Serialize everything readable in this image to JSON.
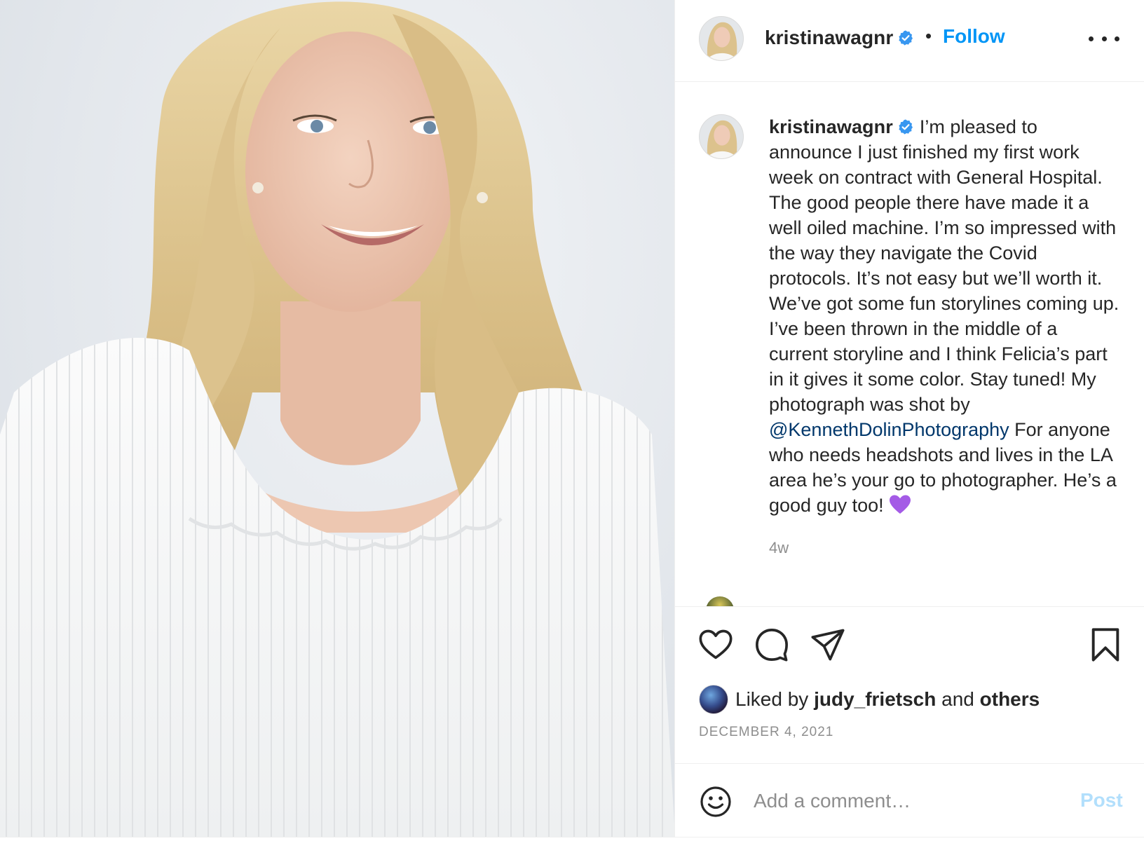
{
  "colors": {
    "accent": "#0095f6",
    "mention": "#00376b",
    "verified": "#3897f0",
    "muted": "#8e8e8e",
    "post_disabled": "#b2dffc",
    "heart_emoji": "#a45be6"
  },
  "header": {
    "username": "kristinawagnr",
    "separator": "•",
    "follow_label": "Follow",
    "more_icon": "more-horizontal-icon"
  },
  "caption": {
    "username": "kristinawagnr",
    "text_before_mention": "I’m pleased to announce I just finished my first work week on contract with General Hospital. The good people there have made it a well oiled machine. I’m so impressed with the way they navigate the Covid protocols. It’s not easy but we’ll worth it. We’ve got some fun storylines coming up. I’ve been thrown in the middle of a current storyline and I think Felicia’s part in it gives it some color. Stay tuned! My photograph was shot by",
    "mention": "@KennethDolinPhotography",
    "text_after_mention": "For anyone who needs headshots and lives in the LA area he’s your go to photographer. He’s a good guy too!",
    "emoji": "purple-heart",
    "age": "4w"
  },
  "actions": {
    "like_icon": "heart-icon",
    "comment_icon": "comment-icon",
    "share_icon": "send-icon",
    "save_icon": "bookmark-icon"
  },
  "likes": {
    "prefix": "Liked by",
    "user": "judy_frietsch",
    "conjunction": "and",
    "others": "others"
  },
  "date": "DECEMBER 4, 2021",
  "comment_box": {
    "emoji_icon": "smiley-icon",
    "placeholder": "Add a comment…",
    "post_label": "Post"
  }
}
